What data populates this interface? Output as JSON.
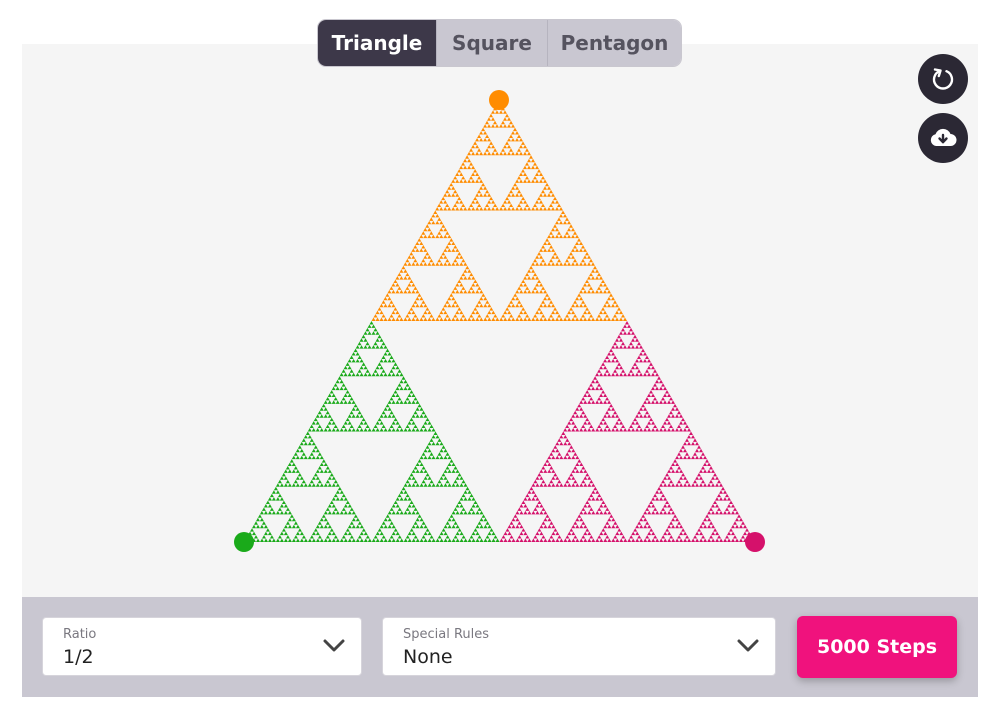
{
  "tabs": [
    {
      "label": "Triangle",
      "active": true
    },
    {
      "label": "Square",
      "active": false
    },
    {
      "label": "Pentagon",
      "active": false
    }
  ],
  "toolbar": {
    "reset_icon": "reset-icon",
    "download_icon": "cloud-download-icon"
  },
  "controls": {
    "ratio": {
      "label": "Ratio",
      "value": "1/2"
    },
    "special_rules": {
      "label": "Special Rules",
      "value": "None"
    },
    "steps_button": "5000 Steps"
  },
  "fractal": {
    "vertex_colors": [
      "#ff8c00",
      "#1aaa1a",
      "#d5116b"
    ]
  }
}
